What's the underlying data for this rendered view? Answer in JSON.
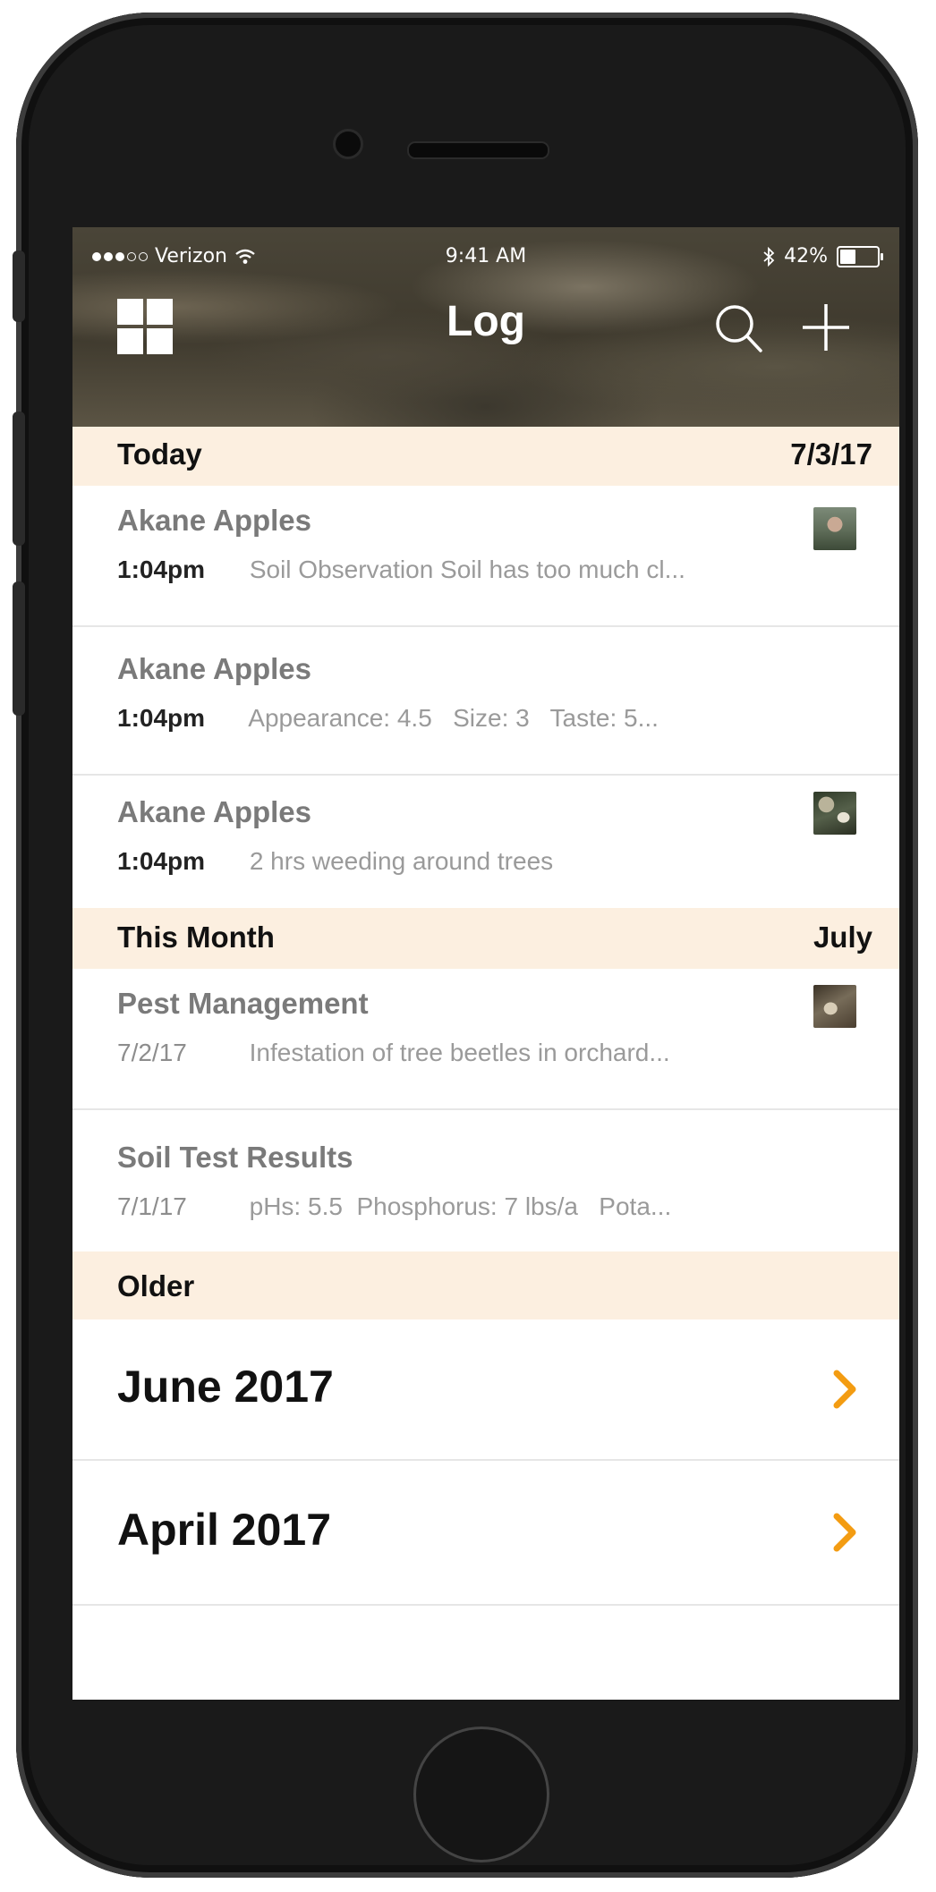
{
  "status_bar": {
    "carrier": "Verizon",
    "time": "9:41 AM",
    "battery": "42%",
    "battery_level": 0.42,
    "icons": [
      "signal-dots-icon",
      "wifi-icon",
      "bluetooth-icon",
      "battery-icon"
    ]
  },
  "nav": {
    "title": "Log",
    "left_icon": "grid-menu-icon",
    "right_icons": [
      "search-icon",
      "plus-icon"
    ]
  },
  "sections": {
    "today": {
      "label": "Today",
      "date": "7/3/17"
    },
    "this_month": {
      "label": "This Month",
      "date": "July"
    },
    "older": {
      "label": "Older"
    }
  },
  "today_entries": [
    {
      "name": "Akane Apples",
      "time": "1:04pm",
      "text": "Soil Observation Soil has too much cl...",
      "thumb": "person-photo"
    },
    {
      "name": "Akane Apples",
      "time": "1:04pm",
      "text": "Appearance: 4.5   Size: 3   Taste: 5..."
    },
    {
      "name": "Akane Apples",
      "time": "1:04pm",
      "text": "2 hrs weeding around trees",
      "thumb": "garden-photo"
    }
  ],
  "month_entries": [
    {
      "name": "Pest Management",
      "date": "7/2/17",
      "text": "Infestation of tree beetles in orchard...",
      "thumb": "pest-photo"
    },
    {
      "name": "Soil Test Results",
      "date": "7/1/17",
      "text": "pHs: 5.5  Phosphorus: 7 lbs/a   Pota..."
    }
  ],
  "older_months": [
    {
      "label": "June 2017"
    },
    {
      "label": "April 2017"
    }
  ],
  "colors": {
    "section_bg": "#fcefe0",
    "chevron": "#f39c12",
    "divider": "#e6e6e6"
  }
}
